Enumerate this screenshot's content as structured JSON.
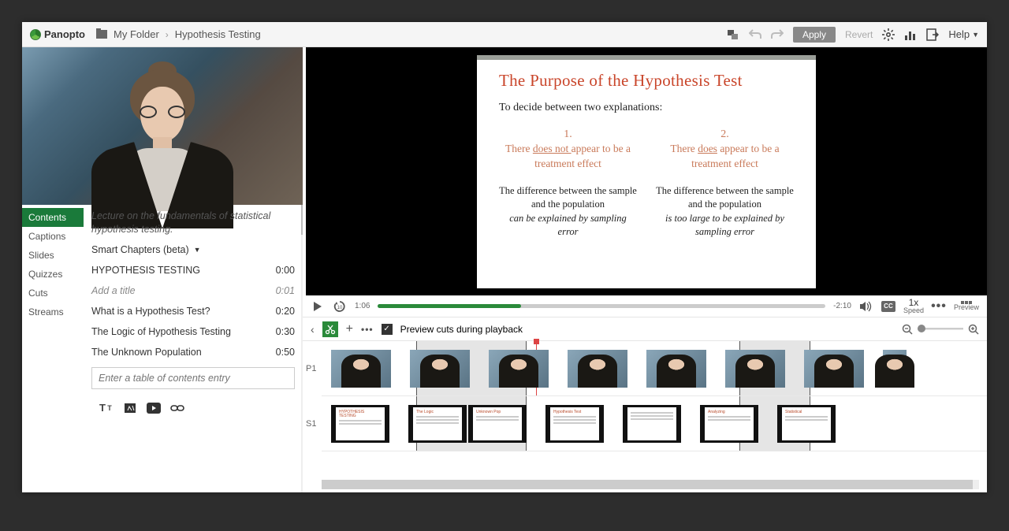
{
  "header": {
    "brand": "Panopto",
    "breadcrumb": {
      "folder": "My Folder",
      "title": "Hypothesis Testing"
    },
    "apply": "Apply",
    "revert": "Revert",
    "help": "Help"
  },
  "sidebar": {
    "tabs": [
      "Contents",
      "Captions",
      "Slides",
      "Quizzes",
      "Cuts",
      "Streams"
    ],
    "active_tab": "Contents",
    "description": "Lecture on the fundamentals of statistical hypothesis testing.",
    "chapters_label": "Smart Chapters (beta)",
    "chapters": [
      {
        "label": "HYPOTHESIS TESTING",
        "time": "0:00"
      },
      {
        "label": "Add a title",
        "time": "0:01",
        "style": "add"
      },
      {
        "label": "What is a Hypothesis Test?",
        "time": "0:20"
      },
      {
        "label": "The Logic of Hypothesis Testing",
        "time": "0:30"
      },
      {
        "label": "The Unknown Population",
        "time": "0:50"
      }
    ],
    "toc_placeholder": "Enter a table of contents entry"
  },
  "slide": {
    "title": "The Purpose of the Hypothesis Test",
    "subtitle": "To decide between two explanations:",
    "col1": {
      "num": "1.",
      "stmt_pre": "There ",
      "stmt_u": "does not ",
      "stmt_post": "appear to be a treatment effect",
      "diff": "The difference between the sample and the population",
      "diff_em": "can be explained by sampling error"
    },
    "col2": {
      "num": "2.",
      "stmt_pre": "There ",
      "stmt_u": "does",
      "stmt_post": " appear to be a treatment effect",
      "diff": "The difference between the sample and the population",
      "diff_em": "is too large to be explained by sampling error"
    }
  },
  "player": {
    "current": "1:06",
    "remaining": "-2:10",
    "speed": "1x",
    "speed_label": "Speed",
    "preview": "Preview",
    "cc": "CC"
  },
  "editor": {
    "preview_cuts": "Preview cuts during playback",
    "tracks": [
      "P1",
      "S1"
    ]
  }
}
